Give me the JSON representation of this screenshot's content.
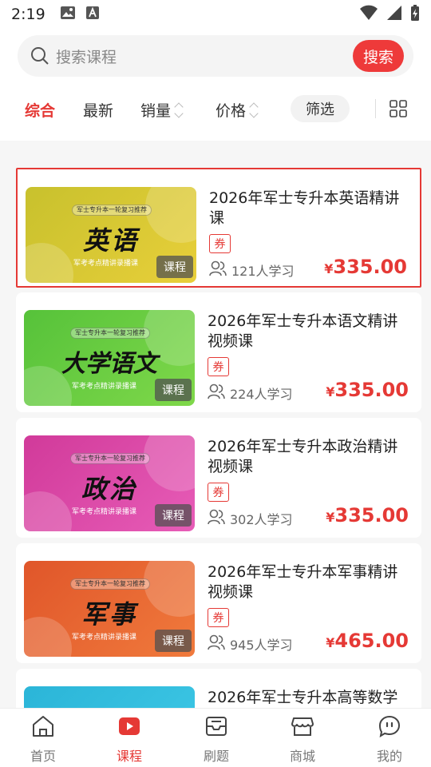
{
  "status": {
    "time": "2:19"
  },
  "search": {
    "placeholder": "搜索课程",
    "button_label": "搜索"
  },
  "filters": {
    "items": [
      "综合",
      "最新",
      "销量",
      "价格"
    ],
    "active": "综合",
    "filter_label": "筛选"
  },
  "courses": [
    {
      "title": "2026年军士专升本英语精讲课",
      "cover_text": "英语",
      "cover_colors": [
        "#c8c12d",
        "#e8cf3a"
      ],
      "coupon": "券",
      "learners": "121人学习",
      "price": "335.00",
      "currency": "¥",
      "badge": "课程",
      "top_tag": "军士专升本一轮复习推荐",
      "sub_tag": "军考考点精讲录播课",
      "selected": true
    },
    {
      "title": "2026年军士专升本语文精讲视频课",
      "cover_text": "大学语文",
      "cover_colors": [
        "#56c23a",
        "#7fd84a"
      ],
      "coupon": "券",
      "learners": "224人学习",
      "price": "335.00",
      "currency": "¥",
      "badge": "课程",
      "top_tag": "军士专升本一轮复习推荐",
      "sub_tag": "军考考点精讲录播课",
      "selected": false
    },
    {
      "title": "2026年军士专升本政治精讲视频课",
      "cover_text": "政治",
      "cover_colors": [
        "#d13a9a",
        "#e75cb7"
      ],
      "coupon": "券",
      "learners": "302人学习",
      "price": "335.00",
      "currency": "¥",
      "badge": "课程",
      "top_tag": "军士专升本一轮复习推荐",
      "sub_tag": "军考考点精讲录播课",
      "selected": false
    },
    {
      "title": "2026年军士专升本军事精讲视频课",
      "cover_text": "军事",
      "cover_colors": [
        "#e0562a",
        "#f07a3c"
      ],
      "coupon": "券",
      "learners": "945人学习",
      "price": "465.00",
      "currency": "¥",
      "badge": "课程",
      "top_tag": "军士专升本一轮复习推荐",
      "sub_tag": "军考考点精讲录播课",
      "selected": false
    },
    {
      "title": "2026年军士专升本高等数学",
      "cover_text": "",
      "cover_colors": [
        "#2bb5d8",
        "#3fc9e6"
      ],
      "coupon": "",
      "learners": "",
      "price": "",
      "currency": "",
      "badge": "",
      "top_tag": "",
      "sub_tag": "",
      "selected": false
    }
  ],
  "nav": [
    {
      "label": "首页",
      "icon": "home-icon"
    },
    {
      "label": "课程",
      "icon": "video-icon",
      "active": true
    },
    {
      "label": "刷题",
      "icon": "inbox-icon"
    },
    {
      "label": "商城",
      "icon": "store-icon"
    },
    {
      "label": "我的",
      "icon": "chat-smile-icon"
    }
  ],
  "colors": {
    "accent": "#e53935",
    "search_button": "#ee3a3a"
  }
}
